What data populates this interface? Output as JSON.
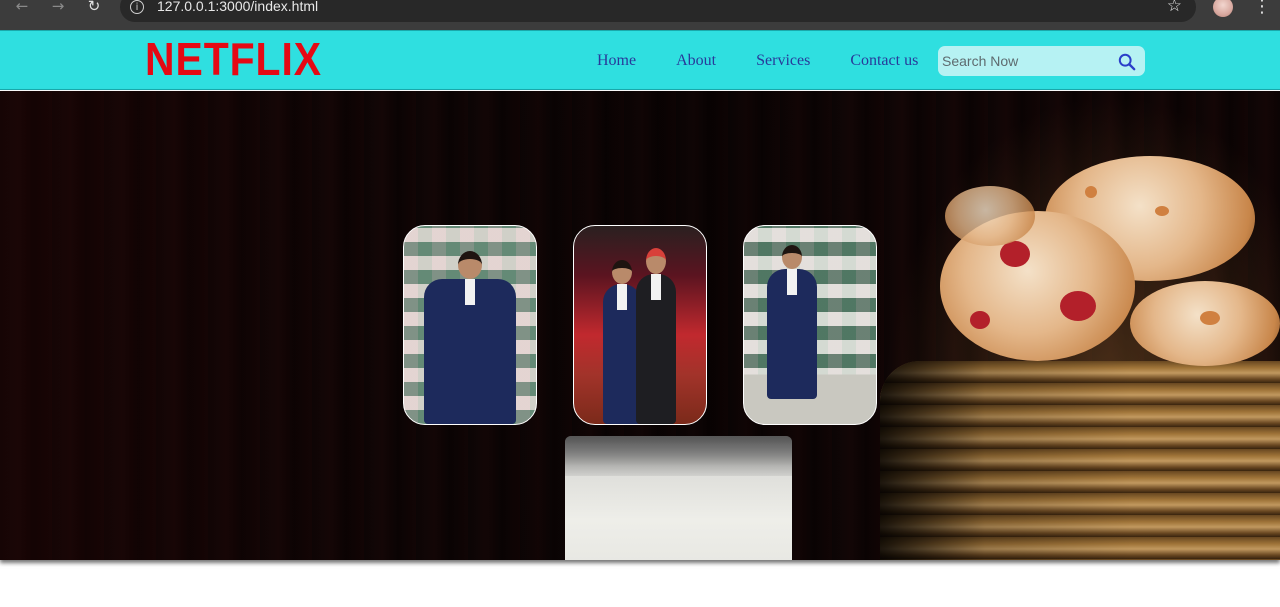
{
  "browser": {
    "url": "127.0.0.1:3000/index.html"
  },
  "navbar": {
    "logo": "NETFLIX",
    "links": [
      "Home",
      "About",
      "Services",
      "Contact us"
    ],
    "search_placeholder": "Search Now"
  },
  "colors": {
    "navbar_bg": "#2fdfe0",
    "logo": "#e50914",
    "link": "#283a9a",
    "search_bg": "#b6f2f3"
  },
  "icons": {
    "back": "arrow-left-icon",
    "forward": "arrow-right-icon",
    "reload": "reload-icon",
    "site_info": "info-icon",
    "bookmark": "star-icon",
    "menu": "vertical-dots-icon",
    "search": "search-icon"
  }
}
